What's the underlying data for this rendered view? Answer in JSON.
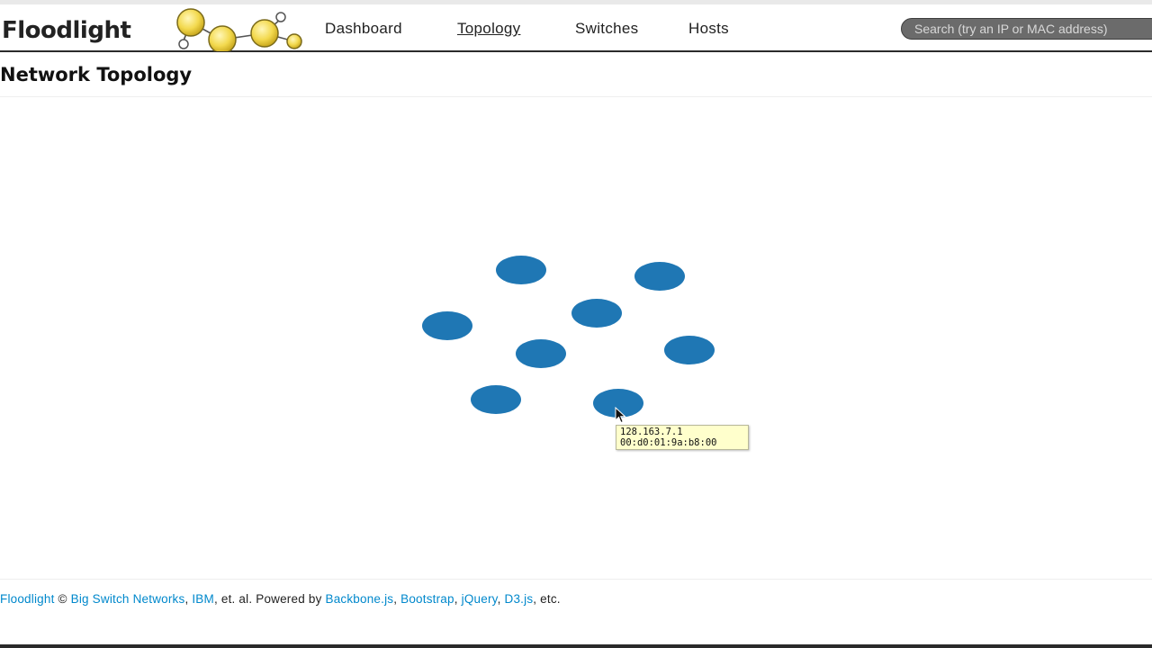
{
  "navbar": {
    "brand": "Floodlight",
    "links": [
      {
        "label": "Dashboard",
        "active": false
      },
      {
        "label": "Topology",
        "active": true
      },
      {
        "label": "Switches",
        "active": false
      },
      {
        "label": "Hosts",
        "active": false
      }
    ],
    "search_placeholder": "Search (try an IP or MAC address)"
  },
  "page": {
    "title": "Network Topology"
  },
  "topology": {
    "node_color": "#1f77b4",
    "node_count": 8
  },
  "tooltip": {
    "ip": "128.163.7.1",
    "mac": "00:d0:01:9a:b8:00"
  },
  "footer": {
    "floodlight": "Floodlight",
    "copyright": " © ",
    "bsn": "Big Switch Networks",
    "sep1": ", ",
    "ibm": "IBM",
    "powered": ", et. al. Powered by ",
    "backbone": "Backbone.js",
    "sep2": ", ",
    "bootstrap": "Bootstrap",
    "sep3": ", ",
    "jquery": "jQuery",
    "sep4": ", ",
    "d3": "D3.js",
    "etc": ", etc."
  },
  "colors": {
    "link": "#0088cc",
    "tooltip_bg": "#ffffcc",
    "search_bg": "#6b6b6b"
  }
}
